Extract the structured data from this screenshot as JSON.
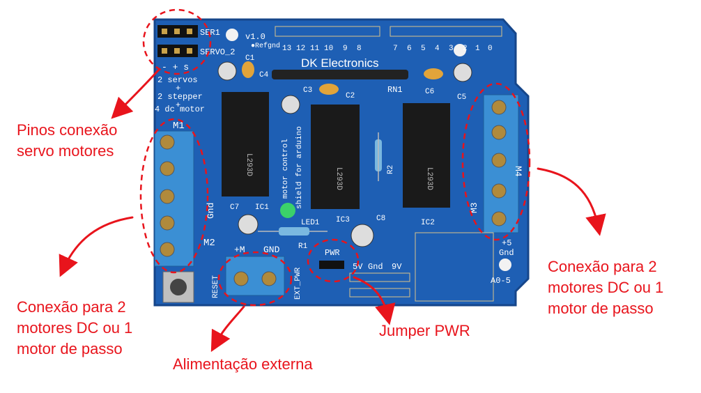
{
  "colors": {
    "board": "#1e5fb4",
    "board_dark": "#16468a",
    "silkscreen": "#ffffff",
    "terminal_block": "#3b8fd4",
    "ic_body": "#1a1a1a",
    "capacitor_tan": "#e2a43a",
    "led": "#3bd16a",
    "annotation": "#e8141c"
  },
  "board": {
    "label_ser1": "SER1",
    "label_servo2": "SERVO_2",
    "label_version": "v1.0",
    "label_arefgnd": "●Refgnd",
    "pin_numbers": [
      "13",
      "12",
      "11",
      "10",
      "9",
      "8",
      "7",
      "6",
      "5",
      "4",
      "3",
      "2",
      "1",
      "0"
    ],
    "label_brand": "DK Electronics",
    "label_minus_plus_s": "- + s",
    "label_features": [
      "2 servos",
      "+",
      "2 stepper",
      "+",
      "4 dc motor"
    ],
    "label_m1": "M1",
    "label_m2": "M2",
    "label_m3": "M3",
    "label_m4": "M4",
    "label_gnd_side": "Gnd",
    "label_c1": "C1",
    "label_c2": "C2",
    "label_c3": "C3",
    "label_c4": "C4",
    "label_c5": "C5",
    "label_c6": "C6",
    "label_c7": "C7",
    "label_c8": "C8",
    "label_ic1": "IC1",
    "label_ic2": "IC2",
    "label_ic3": "IC3",
    "label_rn1": "RN1",
    "label_r1": "R1",
    "label_r2": "R2",
    "label_led1": "LED1",
    "label_motor_control": "motor control",
    "label_shield": "shield for arduino",
    "label_plus_m": "+M",
    "label_gnd": "GND",
    "label_pwr": "PWR",
    "label_5v": "5V",
    "label_gnd2": "Gnd",
    "label_9v": "9V",
    "label_reset": "RESET",
    "label_ext_pwr": "EXT_PWR",
    "label_plus5": "+5",
    "label_gnd3": "Gnd",
    "label_a0_5": "A0-5",
    "ic_marking": "L293D"
  },
  "annotations": {
    "servo": [
      "Pinos conexão",
      "servo motores"
    ],
    "left_motors": [
      "Conexão para 2",
      "motores DC ou 1",
      "motor de passo"
    ],
    "right_motors": [
      "Conexão para 2",
      "motores DC ou 1",
      "motor de passo"
    ],
    "jumper": [
      "Jumper PWR"
    ],
    "power": [
      "Alimentação externa"
    ]
  }
}
